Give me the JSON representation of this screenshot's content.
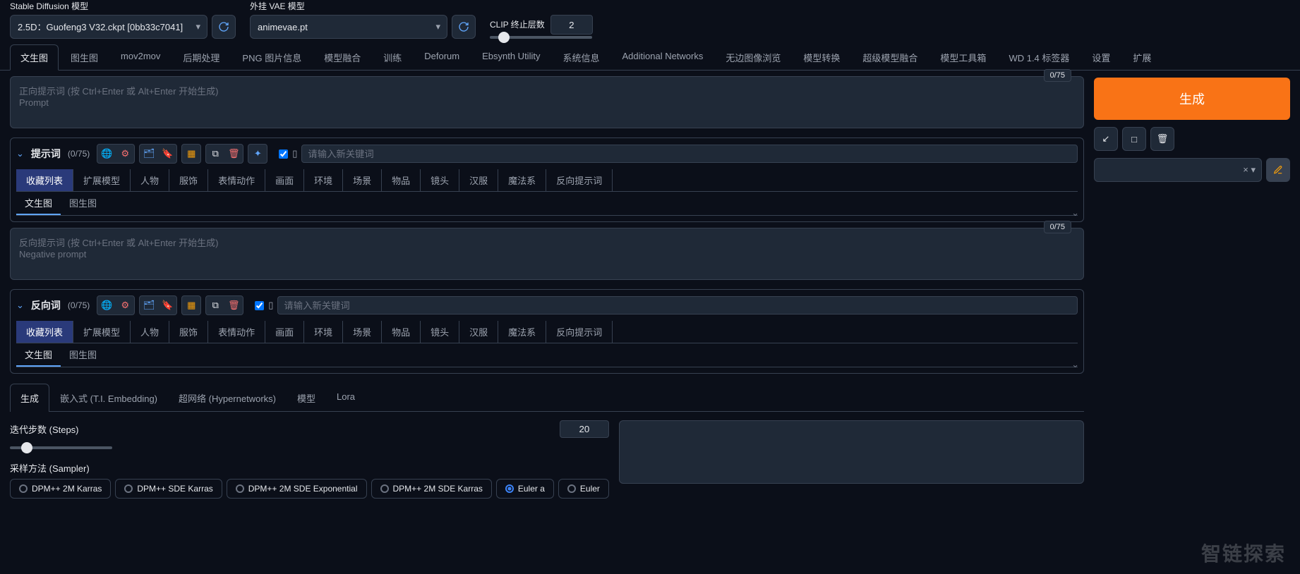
{
  "top": {
    "sd_label": "Stable Diffusion 模型",
    "sd_value": "2.5D：Guofeng3 V32.ckpt [0bb33c7041]",
    "vae_label": "外挂 VAE 模型",
    "vae_value": "animevae.pt",
    "clip_label": "CLIP 终止层数",
    "clip_value": "2"
  },
  "tabs": [
    "文生图",
    "图生图",
    "mov2mov",
    "后期处理",
    "PNG 图片信息",
    "模型融合",
    "训练",
    "Deforum",
    "Ebsynth Utility",
    "系统信息",
    "Additional Networks",
    "无边图像浏览",
    "模型转换",
    "超级模型融合",
    "模型工具箱",
    "WD 1.4 标签器",
    "设置",
    "扩展"
  ],
  "active_tab": 0,
  "prompt": {
    "placeholder": "正向提示词 (按 Ctrl+Enter 或 Alt+Enter 开始生成)\nPrompt",
    "counter": "0/75"
  },
  "neg_prompt": {
    "placeholder": "反向提示词 (按 Ctrl+Enter 或 Alt+Enter 开始生成)\nNegative prompt",
    "counter": "0/75"
  },
  "prompt_section": {
    "title": "提示词",
    "count": "(0/75)",
    "keyword_placeholder": "请输入新关键词"
  },
  "neg_section": {
    "title": "反向词",
    "count": "(0/75)",
    "keyword_placeholder": "请输入新关键词"
  },
  "categories": [
    "收藏列表",
    "扩展模型",
    "人物",
    "服饰",
    "表情动作",
    "画面",
    "环境",
    "场景",
    "物品",
    "镜头",
    "汉服",
    "魔法系",
    "反向提示词"
  ],
  "sub_tabs": [
    "文生图",
    "图生图"
  ],
  "gen_tabs": [
    "生成",
    "嵌入式 (T.I. Embedding)",
    "超网络 (Hypernetworks)",
    "模型",
    "Lora"
  ],
  "steps": {
    "label": "迭代步数 (Steps)",
    "value": "20"
  },
  "sampler": {
    "label": "采样方法 (Sampler)",
    "options": [
      "DPM++ 2M Karras",
      "DPM++ SDE Karras",
      "DPM++ 2M SDE Exponential",
      "DPM++ 2M SDE Karras",
      "Euler a",
      "Euler"
    ],
    "selected": 4
  },
  "right": {
    "generate": "生成"
  },
  "watermark": "智链探索"
}
